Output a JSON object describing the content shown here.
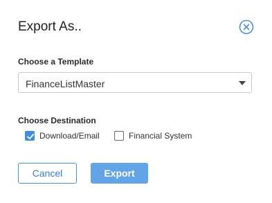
{
  "dialog": {
    "title": "Export As..",
    "close_icon": "close-circle-icon"
  },
  "template": {
    "label": "Choose a Template",
    "selected": "FinanceListMaster"
  },
  "destination": {
    "label": "Choose Destination",
    "options": [
      {
        "label": "Download/Email",
        "checked": true
      },
      {
        "label": "Financial System",
        "checked": false
      }
    ]
  },
  "actions": {
    "cancel_label": "Cancel",
    "export_label": "Export"
  },
  "colors": {
    "accent": "#3f8ee0",
    "export_button": "#63a4e8"
  }
}
